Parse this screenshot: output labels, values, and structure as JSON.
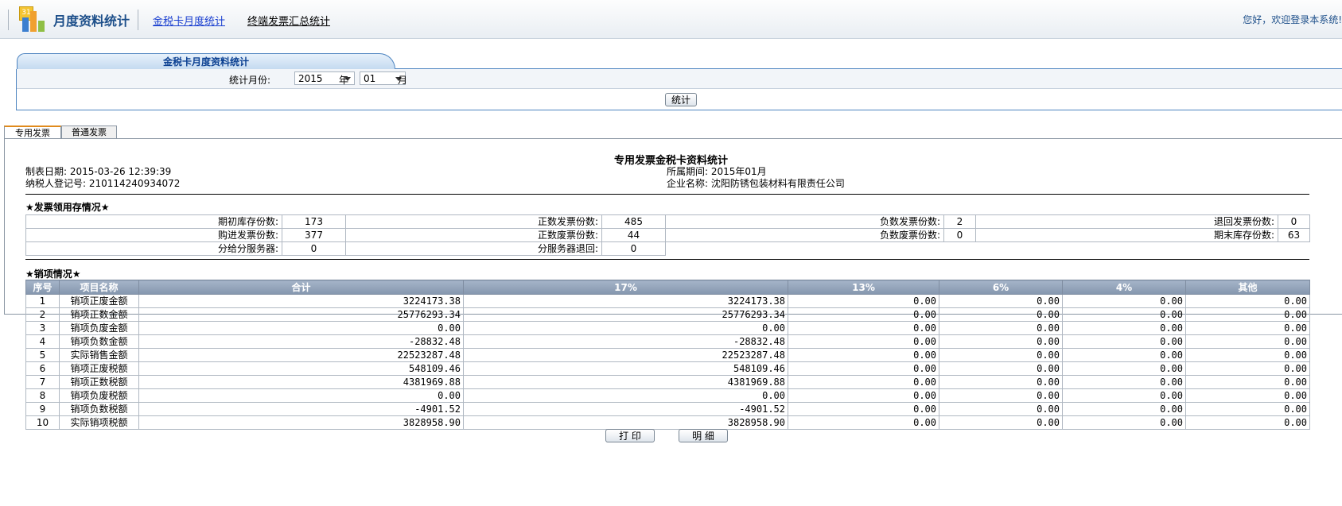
{
  "header": {
    "app_title": "月度资料统计",
    "nav": [
      "金税卡月度统计",
      "终端发票汇总统计"
    ],
    "welcome": "您好，欢迎登录本系统!"
  },
  "panel": {
    "title": "金税卡月度资料统计",
    "month_label": "统计月份:",
    "year_value": "2015",
    "year_unit": "年",
    "month_value": "01",
    "month_unit": "月",
    "stat_button": "统计"
  },
  "tabs": [
    "专用发票",
    "普通发票"
  ],
  "report": {
    "title": "专用发票金税卡资料统计",
    "make_date": "制表日期: 2015-03-26 12:39:39",
    "tax_id": "纳税人登记号: 210114240934072",
    "period": "所属期间: 2015年01月",
    "company": "企业名称: 沈阳防锈包装材料有限责任公司",
    "section_stock": "★发票领用存情况★",
    "section_sales": "★销项情况★"
  },
  "stock": {
    "rows": [
      [
        [
          "期初库存份数:",
          "173"
        ],
        [
          "正数发票份数:",
          "485"
        ],
        [
          "负数发票份数:",
          "2"
        ],
        [
          "退回发票份数:",
          "0"
        ]
      ],
      [
        [
          "购进发票份数:",
          "377"
        ],
        [
          "正数废票份数:",
          "44"
        ],
        [
          "负数废票份数:",
          "0"
        ],
        [
          "期末库存份数:",
          "63"
        ]
      ],
      [
        [
          "分给分服务器:",
          "0"
        ],
        [
          "分服务器退回:",
          "0"
        ]
      ]
    ]
  },
  "sales": {
    "headers": [
      "序号",
      "项目名称",
      "合计",
      "17%",
      "13%",
      "6%",
      "4%",
      "其他"
    ],
    "rows": [
      [
        "1",
        "销项正废金额",
        "3224173.38",
        "3224173.38",
        "0.00",
        "0.00",
        "0.00",
        "0.00"
      ],
      [
        "2",
        "销项正数金额",
        "25776293.34",
        "25776293.34",
        "0.00",
        "0.00",
        "0.00",
        "0.00"
      ],
      [
        "3",
        "销项负废金额",
        "0.00",
        "0.00",
        "0.00",
        "0.00",
        "0.00",
        "0.00"
      ],
      [
        "4",
        "销项负数金额",
        "-28832.48",
        "-28832.48",
        "0.00",
        "0.00",
        "0.00",
        "0.00"
      ],
      [
        "5",
        "实际销售金额",
        "22523287.48",
        "22523287.48",
        "0.00",
        "0.00",
        "0.00",
        "0.00"
      ],
      [
        "6",
        "销项正废税额",
        "548109.46",
        "548109.46",
        "0.00",
        "0.00",
        "0.00",
        "0.00"
      ],
      [
        "7",
        "销项正数税额",
        "4381969.88",
        "4381969.88",
        "0.00",
        "0.00",
        "0.00",
        "0.00"
      ],
      [
        "8",
        "销项负废税额",
        "0.00",
        "0.00",
        "0.00",
        "0.00",
        "0.00",
        "0.00"
      ],
      [
        "9",
        "销项负数税额",
        "-4901.52",
        "-4901.52",
        "0.00",
        "0.00",
        "0.00",
        "0.00"
      ],
      [
        "10",
        "实际销项税额",
        "3828958.90",
        "3828958.90",
        "0.00",
        "0.00",
        "0.00",
        "0.00"
      ]
    ]
  },
  "buttons": {
    "print": "打 印",
    "detail": "明 细"
  }
}
